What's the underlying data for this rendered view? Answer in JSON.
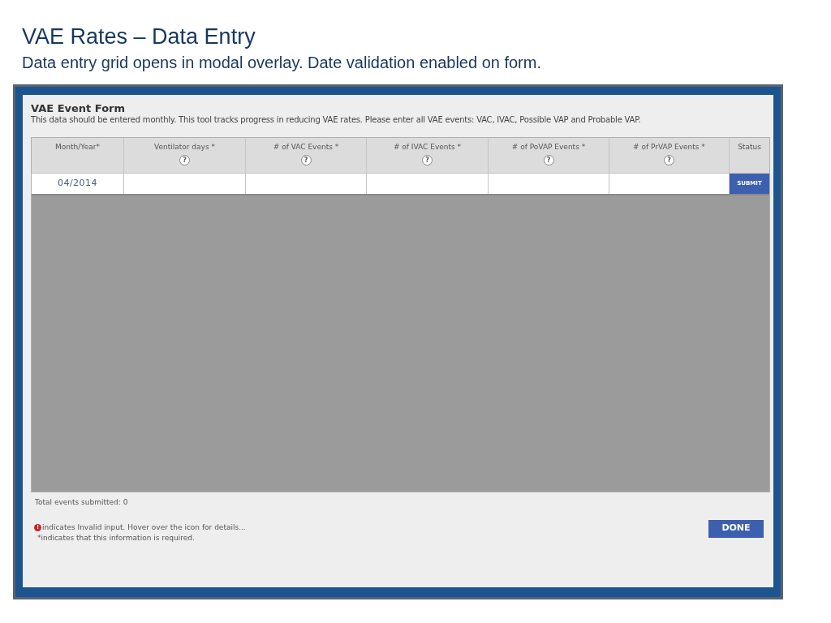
{
  "slide": {
    "title": "VAE Rates – Data Entry",
    "subtitle": "Data entry grid opens in modal overlay. Date validation enabled on form."
  },
  "form": {
    "title": "VAE Event Form",
    "description": "This data should be entered monthly. This tool tracks progress in reducing VAE rates. Please enter all VAE events: VAC, IVAC, Possible VAP and Probable VAP.",
    "columns": [
      {
        "label": "Month/Year*"
      },
      {
        "label": "Ventilator days *",
        "help": "?"
      },
      {
        "label": "# of VAC Events *",
        "help": "?"
      },
      {
        "label": "# of IVAC Events *",
        "help": "?"
      },
      {
        "label": "# of PoVAP Events *",
        "help": "?"
      },
      {
        "label": "# of PrVAP Events *",
        "help": "?"
      },
      {
        "label": "Status"
      }
    ],
    "row": {
      "month": "04/2014",
      "submit": "SUBMIT"
    },
    "total": "Total events submitted: 0",
    "invalid_icon": "!",
    "invalid_note": "indicates Invalid input. Hover over the icon for details...",
    "required_note": "*indicates that this information is required.",
    "done": "DONE"
  }
}
